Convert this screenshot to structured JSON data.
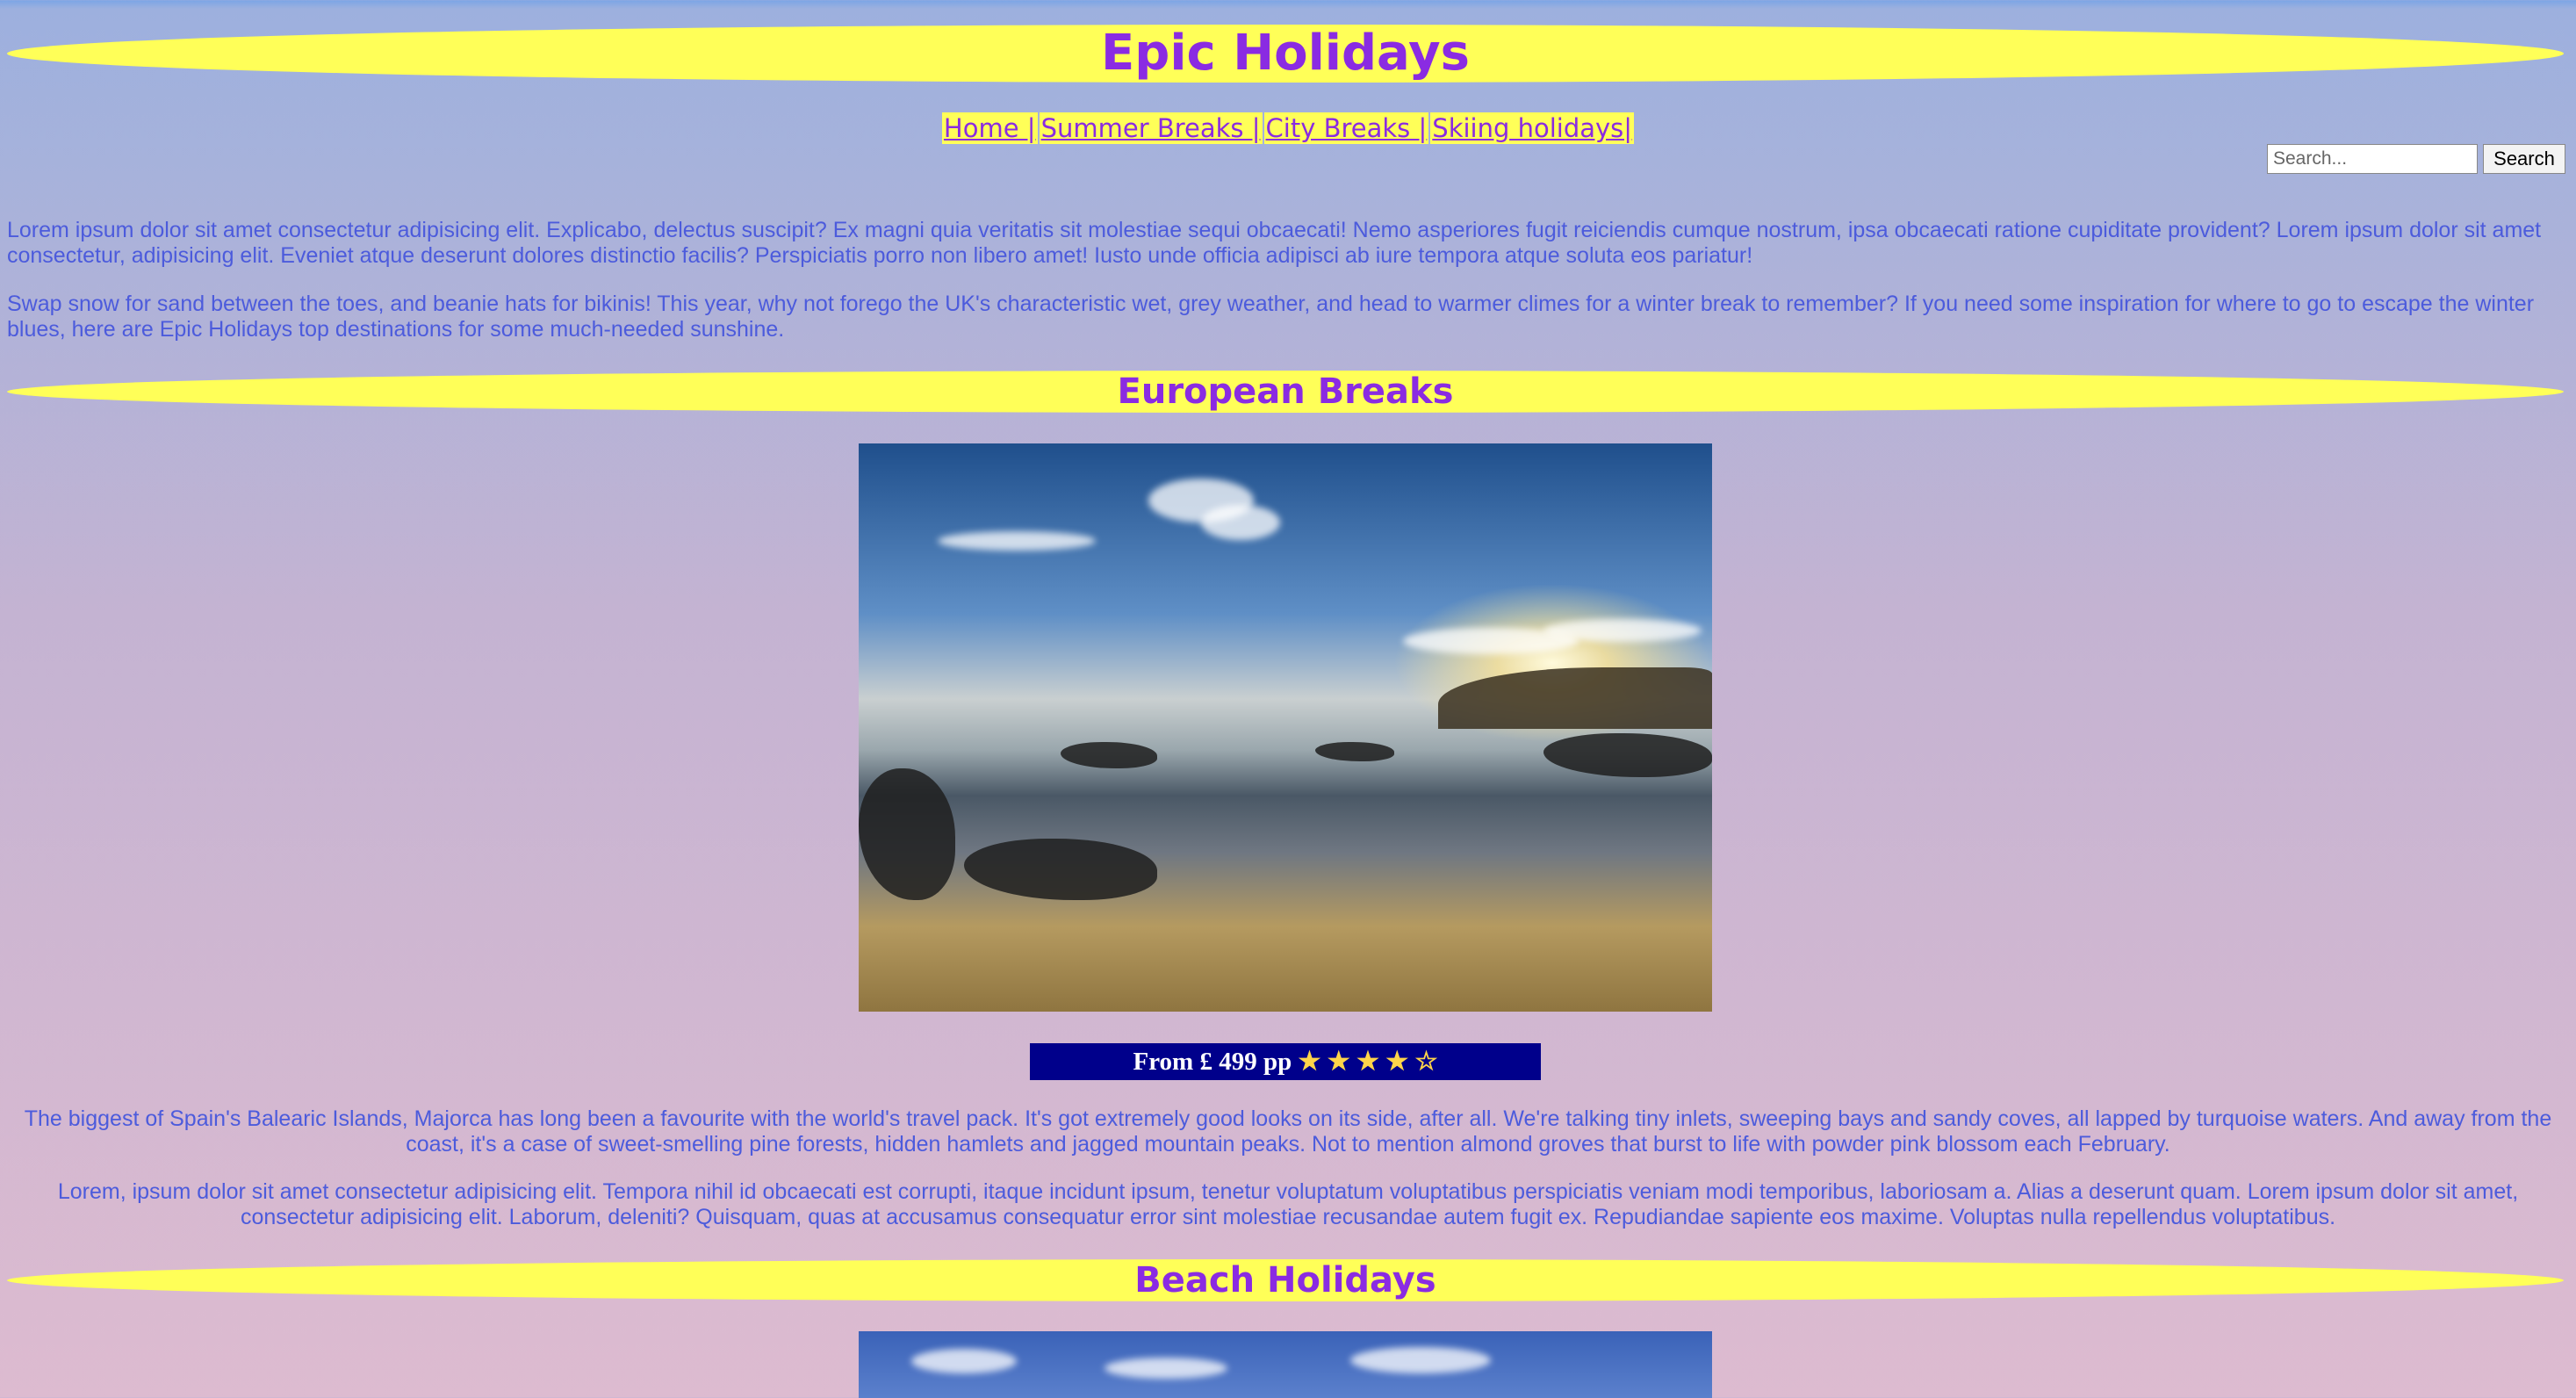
{
  "site_title": "Epic Holidays",
  "nav": {
    "items": [
      {
        "label": "Home |"
      },
      {
        "label": "Summer Breaks |"
      },
      {
        "label": "City Breaks |"
      },
      {
        "label": "Skiing holidays|"
      }
    ]
  },
  "search": {
    "placeholder": "Search...",
    "button_label": "Search"
  },
  "intro": {
    "p1": "Lorem ipsum dolor sit amet consectetur adipisicing elit. Explicabo, delectus suscipit? Ex magni quia veritatis sit molestiae sequi obcaecati! Nemo asperiores fugit reiciendis cumque nostrum, ipsa obcaecati ratione cupiditate provident? Lorem ipsum dolor sit amet consectetur, adipisicing elit. Eveniet atque deserunt dolores distinctio facilis? Perspiciatis porro non libero amet! Iusto unde officia adipisci ab iure tempora atque soluta eos pariatur!",
    "p2": "Swap snow for sand between the toes, and beanie hats for bikinis! This year, why not forego the UK's characteristic wet, grey weather, and head to warmer climes for a winter break to remember? If you need some inspiration for where to go to escape the winter blues, here are Epic Holidays top destinations for some much-needed sunshine."
  },
  "sections": {
    "european": {
      "title": "European Breaks",
      "price": "From £ 499 pp",
      "stars": "★ ★ ★ ★ ☆",
      "p1": "The biggest of Spain's Balearic Islands, Majorca has long been a favourite with the world's travel pack. It's got extremely good looks on its side, after all. We're talking tiny inlets, sweeping bays and sandy coves, all lapped by turquoise waters. And away from the coast, it's a case of sweet-smelling pine forests, hidden hamlets and jagged mountain peaks. Not to mention almond groves that burst to life with powder pink blossom each February.",
      "p2": "Lorem, ipsum dolor sit amet consectetur adipisicing elit. Tempora nihil id obcaecati est corrupti, itaque incidunt ipsum, tenetur voluptatum voluptatibus perspiciatis veniam modi temporibus, laboriosam a. Alias a deserunt quam. Lorem ipsum dolor sit amet, consectetur adipisicing elit. Laborum, deleniti? Quisquam, quas at accusamus consequatur error sint molestiae recusandae autem fugit ex. Repudiandae sapiente eos maxime. Voluptas nulla repellendus voluptatibus."
    },
    "beach": {
      "title": "Beach Holidays"
    }
  },
  "colors": {
    "banner": "#ffff58",
    "heading_text": "#8a2be2",
    "body_text": "#4c5bdc",
    "price_bg": "#00008b",
    "star": "#ffd54a"
  }
}
